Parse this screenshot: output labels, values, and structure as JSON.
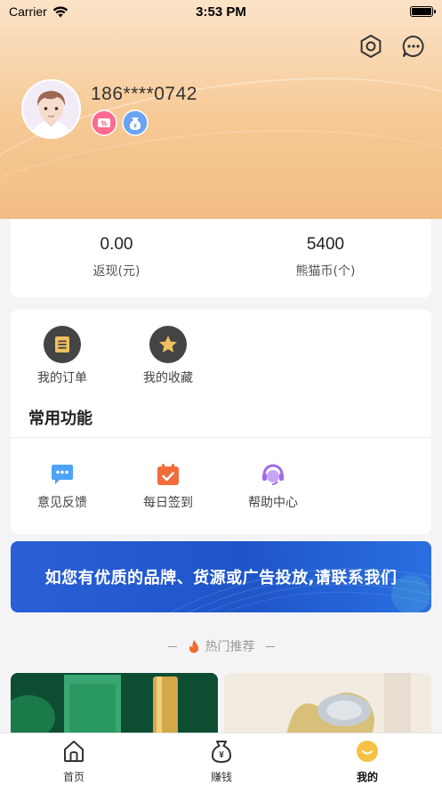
{
  "status_bar": {
    "carrier": "Carrier",
    "time": "3:53 PM"
  },
  "header": {
    "username": "186****0742",
    "icons": [
      "settings-icon",
      "message-icon"
    ],
    "badges": [
      "coupon-badge",
      "money-bag-badge"
    ],
    "gradient_colors": [
      "#fbe3c8",
      "#f2bd84"
    ]
  },
  "stats": [
    {
      "value": "0.00",
      "label": "返现(元)"
    },
    {
      "value": "5400",
      "label": "熊猫币(个)"
    }
  ],
  "orders": {
    "items": [
      {
        "label": "我的订单",
        "icon": "order-list-icon"
      },
      {
        "label": "我的收藏",
        "icon": "star-icon"
      }
    ]
  },
  "common_functions": {
    "title": "常用功能",
    "items": [
      {
        "label": "意见反馈",
        "icon": "feedback-icon",
        "color": "#4da3f5"
      },
      {
        "label": "每日签到",
        "icon": "calendar-check-icon",
        "color": "#f26b3a"
      },
      {
        "label": "帮助中心",
        "icon": "customer-service-icon",
        "color": "#a06be8"
      }
    ]
  },
  "banner": {
    "text": "如您有优质的品牌、货源或广告投放,请联系我们",
    "color": "#1e55c9"
  },
  "hot": {
    "title": "热门推荐"
  },
  "tabbar": {
    "tabs": [
      {
        "label": "首页",
        "icon": "home-icon"
      },
      {
        "label": "赚钱",
        "icon": "money-bag-icon"
      },
      {
        "label": "我的",
        "icon": "smile-face-icon",
        "active": true
      }
    ],
    "accent": "#f5c242"
  }
}
